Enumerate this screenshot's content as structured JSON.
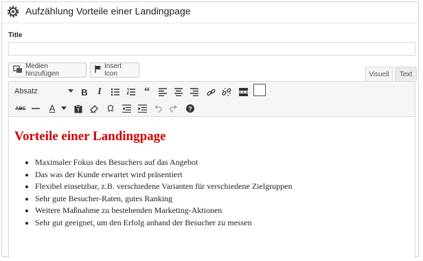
{
  "header": {
    "title": "Aufzählung Vorteile einer Landingpage",
    "icon": "gear-icon"
  },
  "title_field": {
    "label": "Title",
    "value": ""
  },
  "buttons": {
    "media": "Medien hinzufügen",
    "insert_icon": "Insert Icon"
  },
  "tabs": {
    "visual": "Visuell",
    "text": "Text"
  },
  "toolbar": {
    "format_select": "Absatz",
    "row1_icons": [
      "bold-icon",
      "italic-icon",
      "bullet-list-icon",
      "numbered-list-icon",
      "blockquote-icon",
      "align-left-icon",
      "align-center-icon",
      "align-right-icon",
      "link-icon",
      "unlink-icon",
      "read-more-icon",
      "toolbar-toggle-icon"
    ],
    "row2_icons": [
      "strikethrough-icon",
      "horizontal-rule-icon",
      "text-color-icon",
      "paste-text-icon",
      "clear-format-icon",
      "special-char-icon",
      "outdent-icon",
      "indent-icon",
      "undo-icon",
      "redo-icon",
      "help-icon"
    ]
  },
  "content": {
    "heading": "Vorteile einer Landingpage",
    "heading_color": "#d40000",
    "items": [
      "Maximaler Fokus des Besuchers auf das Angebot",
      "Das was der Kunde erwartet wird präsentiert",
      "Flexibel einsetzbar, z.B. verschiedene Varianten für verschiedene Zielgruppen",
      "Sehr gute Besucher-Raten, gutes Ranking",
      "Weitere Maßnahme zu bestehenden Marketing-Aktionen",
      "Sehr gut geeignet, um den Erfolg anhand der Besucher zu messen"
    ]
  }
}
